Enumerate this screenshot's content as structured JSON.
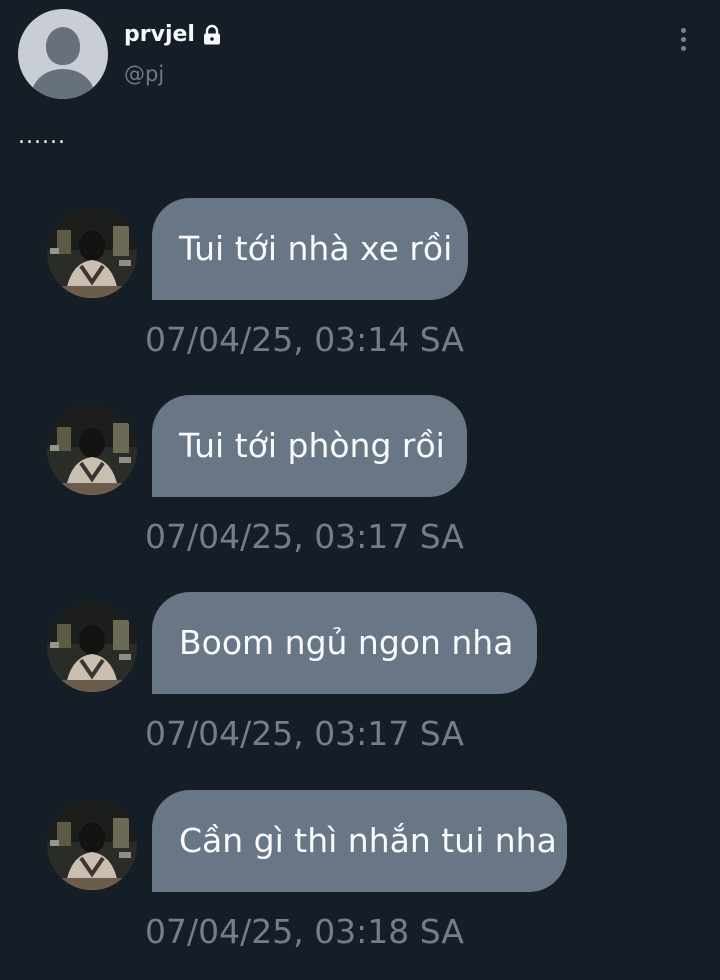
{
  "post": {
    "display_name": "prvjel",
    "handle": "@pj",
    "text": "......",
    "lock_icon": "lock-icon",
    "more_icon": "more-vertical-icon"
  },
  "messages": [
    {
      "text": "Tui tới nhà xe rồi",
      "timestamp": "07/04/25, 03:14 SA"
    },
    {
      "text": "Tui tới phòng rồi",
      "timestamp": "07/04/25, 03:17 SA"
    },
    {
      "text": "Boom ngủ ngon nha",
      "timestamp": "07/04/25, 03:17 SA"
    },
    {
      "text": "Cần gì thì nhắn tui nha",
      "timestamp": "07/04/25, 03:18 SA"
    }
  ],
  "colors": {
    "background": "#151d27",
    "bubble": "#687686",
    "timestamp": "#737e89",
    "handle": "#6f7a86"
  }
}
